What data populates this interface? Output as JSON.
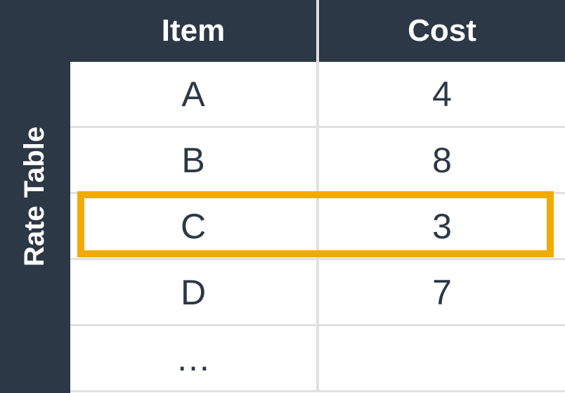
{
  "sidebar": {
    "label": "Rate Table"
  },
  "table": {
    "headers": [
      "Item",
      "Cost"
    ],
    "rows": [
      {
        "item": "A",
        "cost": "4"
      },
      {
        "item": "B",
        "cost": "8"
      },
      {
        "item": "C",
        "cost": "3"
      },
      {
        "item": "D",
        "cost": "7"
      },
      {
        "item": "…",
        "cost": ""
      }
    ],
    "highlighted_row_index": 2
  },
  "chart_data": {
    "type": "table",
    "title": "Rate Table",
    "columns": [
      "Item",
      "Cost"
    ],
    "rows": [
      [
        "A",
        4
      ],
      [
        "B",
        8
      ],
      [
        "C",
        3
      ],
      [
        "D",
        7
      ]
    ],
    "highlighted_row": [
      "C",
      3
    ]
  }
}
